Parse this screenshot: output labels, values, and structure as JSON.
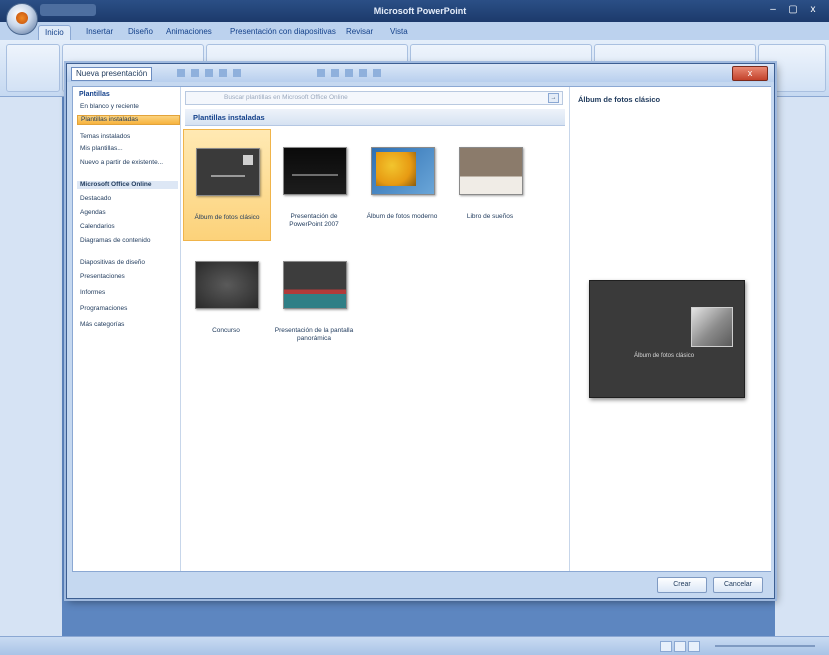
{
  "app": {
    "title": "Microsoft PowerPoint"
  },
  "window_controls": {
    "minimize": "–",
    "maximize": "▢",
    "close": "x"
  },
  "ribbon_tabs": [
    "Inicio",
    "Insertar",
    "Diseño",
    "Animaciones",
    "Presentación con diapositivas",
    "Revisar",
    "Vista"
  ],
  "dialog": {
    "title": "Nueva presentación",
    "close_glyph": "x",
    "search_placeholder": "Buscar plantillas en Microsoft Office Online",
    "buttons": {
      "create": "Crear",
      "cancel": "Cancelar"
    }
  },
  "nav": {
    "header": "Plantillas",
    "items": [
      "En blanco y reciente",
      "Plantillas instaladas",
      "Temas instalados",
      "Mis plantillas...",
      "Nuevo a partir de existente...",
      "Microsoft Office Online",
      "Destacado",
      "Agendas",
      "Calendarios",
      "Diagramas de contenido",
      "Diapositivas de diseño",
      "Presentaciones",
      "Informes",
      "Programaciones",
      "Más categorías"
    ]
  },
  "section": {
    "title": "Plantillas instaladas"
  },
  "templates": [
    {
      "label": "Álbum de fotos clásico",
      "selected": true
    },
    {
      "label": "Presentación de PowerPoint 2007",
      "selected": false
    },
    {
      "label": "Álbum de fotos moderno",
      "selected": false
    },
    {
      "label": "Libro de sueños",
      "selected": false
    },
    {
      "label": "Concurso",
      "selected": false
    },
    {
      "label": "Presentación de la pantalla panorámica",
      "selected": false
    }
  ],
  "preview": {
    "title": "Álbum de fotos clásico",
    "slide_caption": "Álbum de fotos clásico"
  },
  "colors": {
    "selected_bg": "#fcd27a",
    "accent": "#15428b",
    "window_bg": "#5d86c0"
  }
}
